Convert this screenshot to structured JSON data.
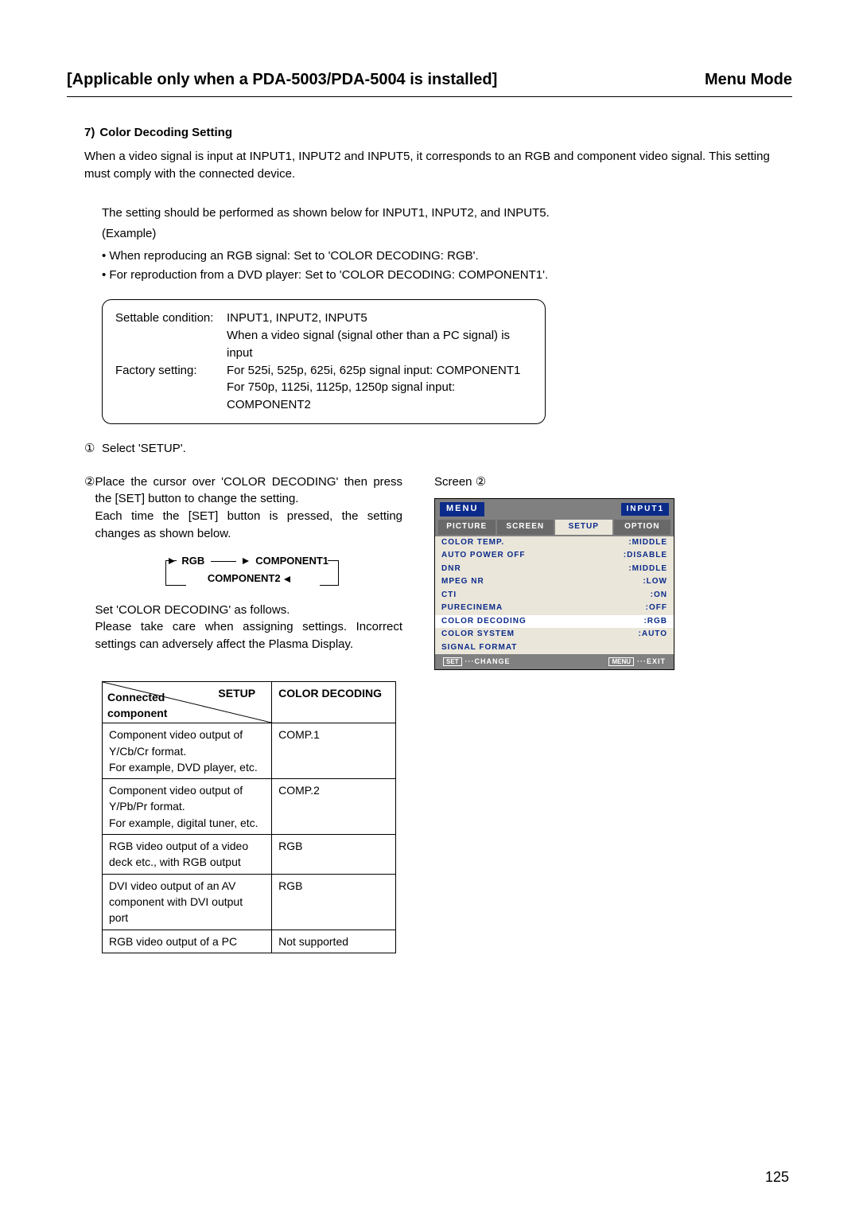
{
  "header": {
    "left_title": "[Applicable only when a PDA-5003/PDA-5004 is installed]",
    "right_title": "Menu Mode"
  },
  "section": {
    "num": "7)",
    "title": "Color Decoding Setting",
    "p1": "When a video signal is input at INPUT1, INPUT2 and INPUT5, it corresponds to an RGB and component video signal. This setting must comply with the connected device.",
    "p2": "The setting should be performed as shown below for INPUT1, INPUT2, and INPUT5.",
    "example_label": "(Example)",
    "bullet1": "• When reproducing an RGB signal:    Set to 'COLOR DECODING: RGB'.",
    "bullet2": "• For reproduction from a DVD player: Set to 'COLOR DECODING: COMPONENT1'."
  },
  "cond_box": {
    "row1_label": "Settable condition:",
    "row1_line1": "INPUT1, INPUT2, INPUT5",
    "row1_line2": "When a video signal (signal other than a PC signal) is input",
    "row2_label": "Factory setting:",
    "row2_line1": "For 525i, 525p, 625i, 625p signal input:  COMPONENT1",
    "row2_line2": "For 750p, 1125i, 1125p, 1250p signal input:  COMPONENT2"
  },
  "steps": {
    "s1_num": "①",
    "s1_text": "Select 'SETUP'.",
    "s2_num": "②",
    "s2_p1": "Place the cursor over 'COLOR DECODING' then press the [SET] button to change the setting.",
    "s2_p2": "Each time the [SET] button is pressed, the setting changes as shown below.",
    "s2_p3": "Set 'COLOR DECODING' as follows.",
    "s2_p4": "Please take care when assigning settings. Incorrect settings can adversely affect the Plasma Display."
  },
  "cycle": {
    "a": "RGB",
    "b": "COMPONENT1",
    "c": "COMPONENT2"
  },
  "setup_table": {
    "head_right_top": "SETUP",
    "head_left_bottom": "Connected\ncomponent",
    "head_col2": "COLOR DECODING",
    "rows": [
      {
        "c": "Component video output of Y/Cb/Cr format.\nFor example, DVD player, etc.",
        "v": "COMP.1"
      },
      {
        "c": "Component video output of Y/Pb/Pr format.\nFor example, digital tuner, etc.",
        "v": "COMP.2"
      },
      {
        "c": "RGB video output of a video deck etc., with RGB output",
        "v": "RGB"
      },
      {
        "c": "DVI video output of an AV component with DVI output port",
        "v": "RGB"
      },
      {
        "c": "RGB video output of a PC",
        "v": "Not supported"
      }
    ]
  },
  "screen_label": "Screen ②",
  "osd": {
    "menu": "MENU",
    "input": "INPUT1",
    "tabs": [
      "PICTURE",
      "SCREEN",
      "SETUP",
      "OPTION"
    ],
    "active_tab_index": 2,
    "rows": [
      {
        "label": "COLOR TEMP.",
        "value": ":MIDDLE",
        "sel": false
      },
      {
        "label": "AUTO POWER OFF",
        "value": ":DISABLE",
        "sel": false
      },
      {
        "label": "DNR",
        "value": ":MIDDLE",
        "sel": false
      },
      {
        "label": "MPEG NR",
        "value": ":LOW",
        "sel": false
      },
      {
        "label": "CTI",
        "value": ":ON",
        "sel": false
      },
      {
        "label": "PURECINEMA",
        "value": ":OFF",
        "sel": false
      },
      {
        "label": "COLOR DECODING",
        "value": ":RGB",
        "sel": true
      },
      {
        "label": "COLOR SYSTEM",
        "value": ":AUTO",
        "sel": false
      },
      {
        "label": "SIGNAL FORMAT",
        "value": "",
        "sel": false
      }
    ],
    "footer_left_key": "SET",
    "footer_left_text": "···CHANGE",
    "footer_right_key": "MENU",
    "footer_right_text": "···EXIT"
  },
  "page_number": "125"
}
